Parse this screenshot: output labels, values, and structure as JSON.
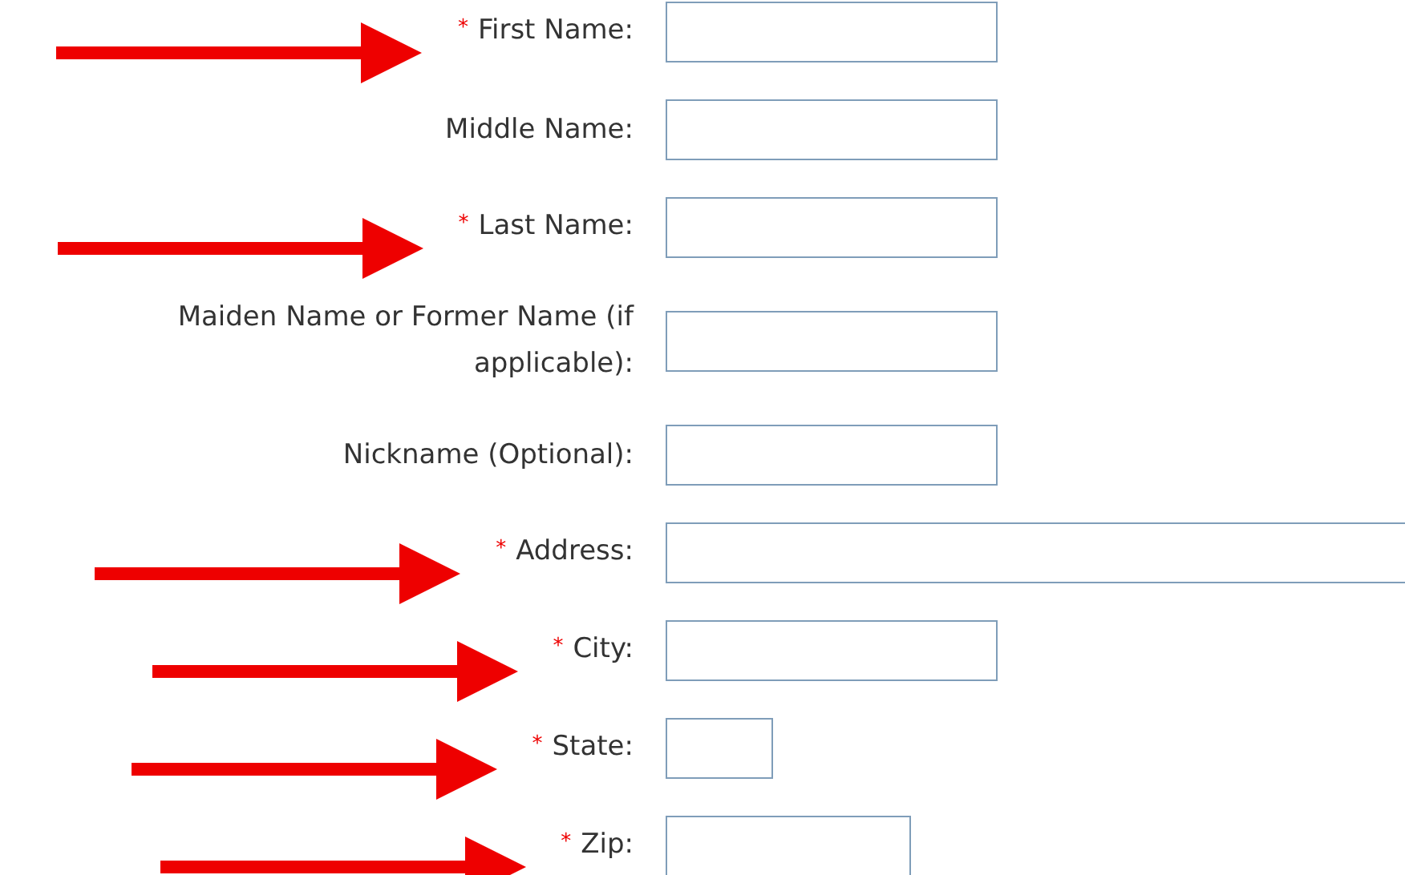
{
  "fields": [
    {
      "label": "First Name:",
      "marker": "*",
      "arrow": true,
      "kind": "medium"
    },
    {
      "label": "Middle Name:",
      "arrow": false,
      "kind": "medium"
    },
    {
      "label": "Last Name:",
      "marker": "*",
      "arrow": true,
      "kind": "medium"
    },
    {
      "label": "Maiden Name or Former Name (if applicable):",
      "arrow": false,
      "kind": "medium"
    },
    {
      "label": "Nickname (Optional):",
      "arrow": false,
      "kind": "medium"
    },
    {
      "label": "Address:",
      "marker": "*",
      "arrow": true,
      "kind": "wide"
    },
    {
      "label": "City:",
      "marker": "*",
      "arrow": true,
      "kind": "medium"
    },
    {
      "label": "State:",
      "marker": "*",
      "arrow": true,
      "kind": "tiny"
    },
    {
      "label": "Zip:",
      "marker": "*",
      "arrow": true,
      "kind": "short"
    }
  ]
}
